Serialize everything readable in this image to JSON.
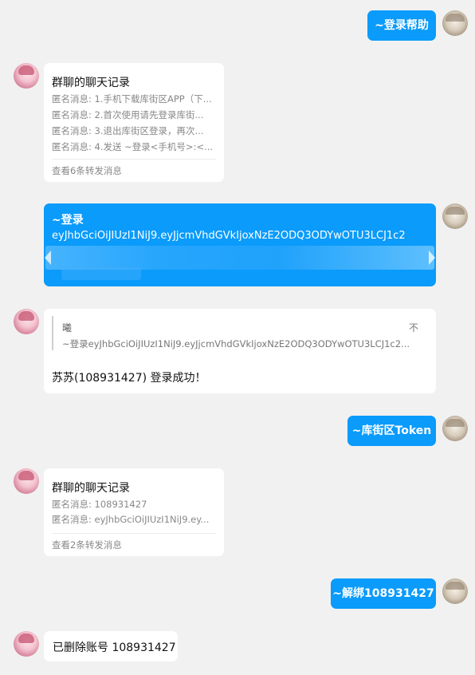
{
  "messages": {
    "m1": {
      "text": "~登录帮助"
    },
    "m2": {
      "title": "群聊的聊天记录",
      "lines": [
        "匿名消息: 1.手机下载库街区APP（下...",
        "匿名消息: 2.首次使用请先登录库街...",
        "匿名消息: 3.退出库街区登录，再次...",
        "匿名消息: 4.发送 ~登录<手机号>:<..."
      ],
      "footer": "查看6条转发消息"
    },
    "m3": {
      "line1": "~登录",
      "line2": "eyJhbGciOiJIUzI1NiJ9.eyJjcmVhdGVkIjoxNzE2ODQ3ODYwOTU3LCJ1c2"
    },
    "m4": {
      "quote_author": "曦",
      "quote_arrow": "不",
      "quote_text": "~登录eyJhbGciOiJIUzI1NiJ9.eyJjcmVhdGVkIjoxNzE2ODQ3ODYwOTU3LCJ1c2...",
      "text": "苏苏(108931427) 登录成功！"
    },
    "m5": {
      "text": "~库街区Token"
    },
    "m6": {
      "title": "群聊的聊天记录",
      "lines": [
        "匿名消息: 108931427",
        "匿名消息: eyJhbGciOiJIUzI1NiJ9.ey..."
      ],
      "footer": "查看2条转发消息"
    },
    "m7": {
      "text": "~解绑108931427"
    },
    "m8": {
      "text": "已删除账号 108931427"
    }
  },
  "colors": {
    "background": "#f1f1f1",
    "user_bubble": "#0a9bfb",
    "card": "#ffffff",
    "muted_text": "#888888"
  }
}
